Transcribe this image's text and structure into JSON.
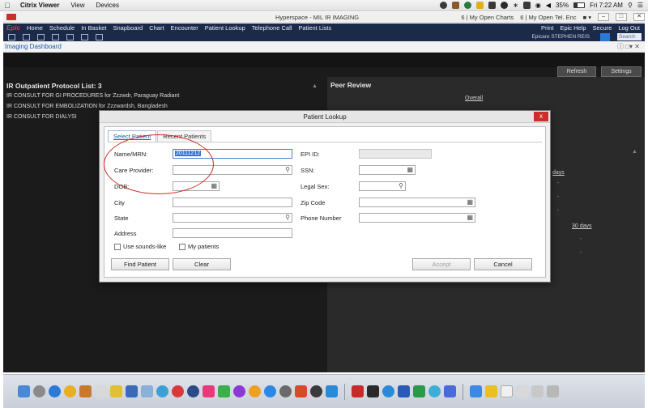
{
  "mac_menubar": {
    "apple": "",
    "app_name": "Citrix Viewer",
    "menus": [
      "View",
      "Devices"
    ],
    "battery": "35%",
    "clock": "Fri 7:22 AM"
  },
  "citrix_window": {
    "title": "Hyperspace - MIL IR IMAGING",
    "tab1": "6 | My Open Charts",
    "tab2": "6 | My Open Tel. Enc"
  },
  "epic_toolbar": {
    "logo": "Epic",
    "items": [
      "Home",
      "Schedule",
      "In Basket",
      "Snapboard",
      "Chart",
      "Encounter",
      "Patient Lookup",
      "Telephone Call",
      "Patient Lists"
    ],
    "right_items": [
      "Print",
      "Epic Help",
      "Secure",
      "Log Out"
    ],
    "user": "Epicare  STEPHEN REIS",
    "search_placeholder": "Search"
  },
  "activity": {
    "title": "Imaging Dashboard"
  },
  "workspace": {
    "refresh_label": "Refresh",
    "settings_label": "Settings",
    "protocol_header": "IR Outpatient Protocol List: 3",
    "protocol_rows": [
      "IR CONSULT FOR GI PROCEDURES for Zzzwdr, Paraguay Radiant",
      "IR CONSULT FOR EMBOLIZATION for Zzzwardsh, Bangladesh",
      "IR CONSULT FOR DIALYSI"
    ],
    "peer_header": "Peer Review",
    "peer_overall": "Overall",
    "peer_days": "days",
    "peer_30days": "30 days"
  },
  "dialog": {
    "title": "Patient Lookup",
    "close": "x",
    "tabs": [
      "Select Patient",
      "Recent Patients"
    ],
    "fields": {
      "name_mrn_label": "Name/MRN:",
      "name_mrn_value": "20111212",
      "care_provider_label": "Care Provider:",
      "dob_label": "DOB:",
      "city_label": "City",
      "state_label": "State",
      "address_label": "Address",
      "epi_id_label": "EPI ID:",
      "ssn_label": "SSN:",
      "legal_sex_label": "Legal Sex:",
      "zip_label": "Zip Code",
      "phone_label": "Phone Number"
    },
    "checkboxes": {
      "sounds_like": "Use sounds-like",
      "my_patients": "My patients"
    },
    "buttons": {
      "find": "Find Patient",
      "clear": "Clear",
      "accept": "Accept",
      "cancel": "Cancel"
    }
  },
  "colors": {
    "epic_bar": "#1c2a4a",
    "workspace_bg": "#1b1b1b",
    "annotation_red": "#d12a2a",
    "link_blue": "#1a5aa8"
  }
}
